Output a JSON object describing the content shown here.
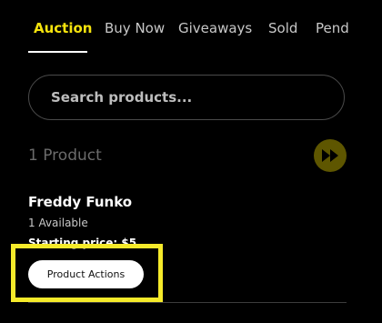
{
  "tabs": [
    {
      "label": "Auction",
      "active": true
    },
    {
      "label": "Buy Now",
      "active": false
    },
    {
      "label": "Giveaways",
      "active": false
    },
    {
      "label": "Sold",
      "active": false
    },
    {
      "label": "Pend",
      "active": false
    }
  ],
  "search": {
    "placeholder": "Search products...",
    "value": ""
  },
  "results": {
    "count_label": "1 Product",
    "action_icon": "fast-forward-icon"
  },
  "product": {
    "name": "Freddy Funko",
    "availability": "1 Available",
    "price_label": "Starting price: $5",
    "actions_label": "Product Actions"
  },
  "colors": {
    "accent": "#f5e30d",
    "highlight": "#f5ea2a",
    "background": "#000000",
    "ff_button": "#5e5600"
  }
}
